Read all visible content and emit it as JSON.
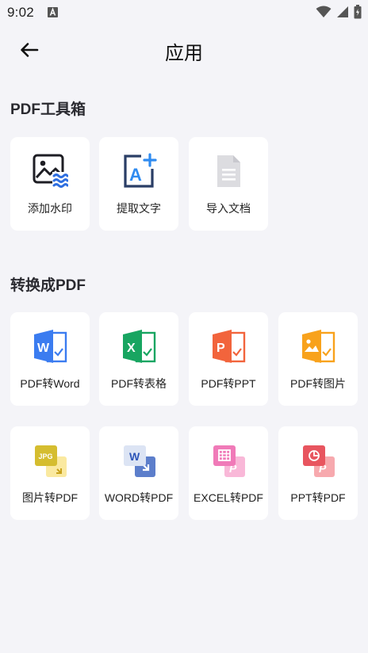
{
  "status_bar": {
    "time": "9:02",
    "icons": [
      "notification-a-icon",
      "wifi-icon",
      "signal-icon",
      "battery-icon"
    ]
  },
  "header": {
    "title": "应用",
    "back_icon": "arrow-left-icon"
  },
  "sections": [
    {
      "title": "PDF工具箱",
      "items": [
        {
          "label": "添加水印",
          "icon": "watermark-icon"
        },
        {
          "label": "提取文字",
          "icon": "extract-text-icon"
        },
        {
          "label": "导入文档",
          "icon": "import-document-icon"
        }
      ]
    },
    {
      "title": "转换成PDF",
      "items": [
        {
          "label": "PDF转Word",
          "icon": "word-doc-icon"
        },
        {
          "label": "PDF转表格",
          "icon": "excel-doc-icon"
        },
        {
          "label": "PDF转PPT",
          "icon": "ppt-doc-icon"
        },
        {
          "label": "PDF转图片",
          "icon": "image-doc-icon"
        },
        {
          "label": "图片转PDF",
          "icon": "jpg-to-pdf-icon"
        },
        {
          "label": "WORD转PDF",
          "icon": "word-to-pdf-icon"
        },
        {
          "label": "EXCEL转PDF",
          "icon": "excel-to-pdf-icon"
        },
        {
          "label": "PPT转PDF",
          "icon": "ppt-to-pdf-icon"
        }
      ]
    }
  ],
  "icon_glyphs": {
    "word_letter": "W",
    "excel_letter": "X",
    "ppt_letter": "P",
    "jpg_text": "JPG",
    "pdf_letter": "P",
    "text_letter": "A"
  },
  "colors": {
    "word": "#3B7CF0",
    "excel": "#18A561",
    "ppt": "#F2643C",
    "image": "#F8A21C",
    "jpg": "#D8C030",
    "word_blue_dark": "#2D55B8",
    "pink": "#F07AB8",
    "red": "#E8555F",
    "background": "#F4F4F8"
  }
}
